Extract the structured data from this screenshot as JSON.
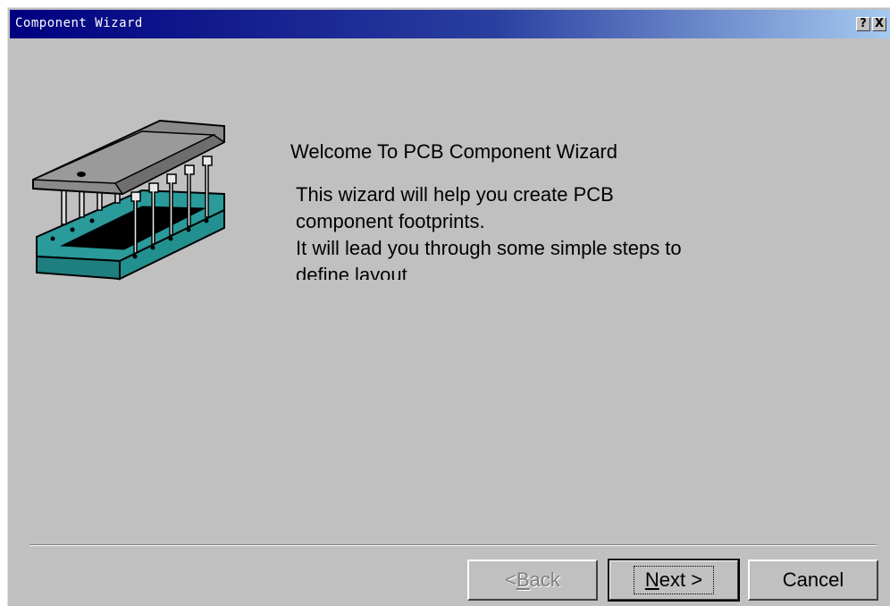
{
  "window": {
    "title": "Component Wizard",
    "help_button": "?",
    "close_button": "X"
  },
  "welcome": {
    "title": "Welcome To PCB Component Wizard",
    "description_lines": [
      "This wizard will help you create PCB",
      "component footprints.",
      "It will lead you through some simple steps to",
      "define layout"
    ]
  },
  "buttons": {
    "back": {
      "prefix": "< ",
      "accel": "B",
      "rest": "ack",
      "enabled": false
    },
    "next": {
      "accel": "N",
      "rest": "ext >",
      "enabled": true
    },
    "cancel": {
      "label": "Cancel",
      "enabled": true
    }
  },
  "colors": {
    "titlebar_start": "#000080",
    "titlebar_end": "#a6caf0",
    "dialog_bg": "#c0c0c0",
    "socket_teal": "#2a9a9a",
    "chip_gray": "#8a8a8a"
  },
  "icons": [
    "ic-chip-socket-illustration",
    "help-icon",
    "close-icon"
  ]
}
